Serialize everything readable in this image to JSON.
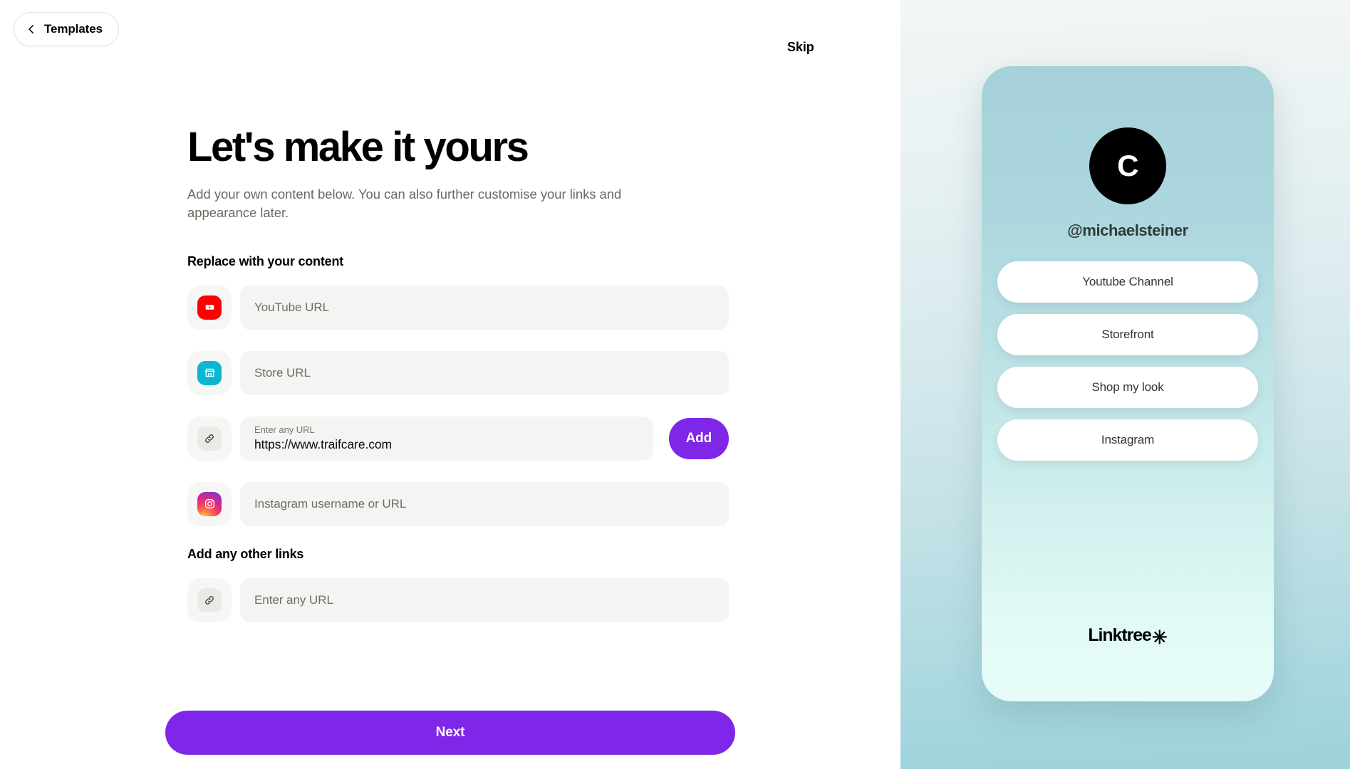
{
  "header": {
    "back_button_label": "Templates",
    "skip_label": "Skip"
  },
  "main": {
    "title": "Let's make it yours",
    "subtitle": "Add your own content below. You can also further customise your links and appearance later.",
    "section_replace_label": "Replace with your content",
    "section_other_label": "Add any other links",
    "next_label": "Next",
    "fields": [
      {
        "icon": "youtube-icon",
        "placeholder": "YouTube URL",
        "value": "",
        "float_label": "",
        "has_add_button": false
      },
      {
        "icon": "store-icon",
        "placeholder": "Store URL",
        "value": "",
        "float_label": "",
        "has_add_button": false
      },
      {
        "icon": "link-icon",
        "placeholder": "Enter any URL",
        "value": "https://www.traifcare.com",
        "float_label": "Enter any URL",
        "has_add_button": true,
        "add_label": "Add"
      },
      {
        "icon": "instagram-icon",
        "placeholder": "Instagram username or URL",
        "value": "",
        "float_label": "",
        "has_add_button": false
      }
    ],
    "other_field": {
      "icon": "link-icon",
      "placeholder": "Enter any URL",
      "value": ""
    }
  },
  "preview": {
    "avatar_initial": "C",
    "handle": "@michaelsteiner",
    "links": [
      {
        "label": "Youtube Channel"
      },
      {
        "label": "Storefront"
      },
      {
        "label": "Shop my look"
      },
      {
        "label": "Instagram"
      }
    ],
    "logo_word": "Linktree",
    "logo_asterisk": "✳"
  },
  "colors": {
    "accent_purple": "#7f27e8",
    "youtube_red": "#ff0000",
    "store_cyan": "#0cb6cf",
    "input_bg": "#f4f4f2",
    "phone_bg_top": "#a6d1da",
    "phone_bg_bottom": "#e6fcf8"
  }
}
